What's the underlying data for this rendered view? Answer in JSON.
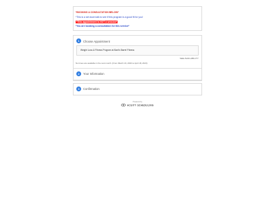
{
  "notice": {
    "line1": "*BOOKING A CONSULTATION BELOW*",
    "line2": "*This is a set down talk to see if this program is a good fit for you!",
    "line3": "*This appointment is NOT a session*",
    "line4": "*You are booking a consultation for this service*"
  },
  "steps": [
    {
      "number": "1",
      "title": "Choose Appointment"
    },
    {
      "number": "2",
      "title": "Your Information"
    },
    {
      "number": "3",
      "title": "Confirmation"
    }
  ],
  "appointment": {
    "service_name": "Weight Loss & Fitness Program at Baxt's Barrel Fitness",
    "availability_link": "SEE AVAILABILITY",
    "dates_note": "No times are available in the next month. (From March 19, 2023 to April 18, 2023)"
  },
  "footer": {
    "powered_by": "Powered by",
    "brand": "ACUITY SCHEDULING"
  },
  "colors": {
    "accent": "#2f7de1",
    "alert_red": "#d9261c",
    "highlight_red": "#ff1e1e",
    "link_blue": "#2747c8"
  }
}
